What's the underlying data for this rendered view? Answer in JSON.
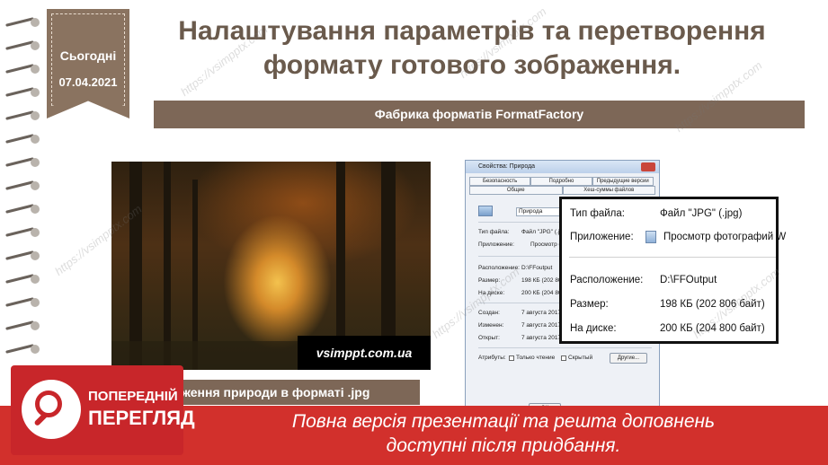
{
  "ribbon": {
    "day": "Сьогодні",
    "date": "07.04.2021"
  },
  "title": {
    "line1": "Налаштування параметрів та перетворення",
    "line2": "формату готового зображення."
  },
  "subtitle": "Фабрика форматів FormatFactory",
  "photo": {
    "watermark": "vsimppt.com.ua"
  },
  "caption": "ження природи в форматі .jpg",
  "dialog": {
    "title": "Свойства: Природа",
    "tabs": [
      "Безопасность",
      "Подробно",
      "Предыдущие версии",
      "Общие",
      "Хеш-суммы файлов"
    ],
    "name": "Природа",
    "type_label": "Тип файла:",
    "type_value": "Файл \"JPG\" (.jp",
    "app_label": "Приложение:",
    "app_value": "Просмотр ф",
    "location_label": "Расположение:",
    "location_value": "D:\\FFoutput",
    "size_label": "Размер:",
    "size_value": "198 КБ (202 80",
    "disk_label": "На диске:",
    "disk_value": "200 КБ (204 80",
    "created_label": "Создан:",
    "created_value": "7 августа 2017",
    "modified_label": "Изменен:",
    "modified_value": "7 августа 2017",
    "opened_label": "Открыт:",
    "opened_value": "7 августа 2017",
    "attrs_label": "Атрибуты:",
    "readonly_label": "Только чтение",
    "hidden_label": "Скрытый",
    "other_button": "Другие...",
    "ok_button": "ОК"
  },
  "zoom": {
    "type_label": "Тип файла:",
    "type_value": "Файл \"JPG\" (.jpg)",
    "app_label": "Приложение:",
    "app_value": "Просмотр фотографий W",
    "location_label": "Расположение:",
    "location_value": "D:\\FFOutput",
    "size_label": "Размер:",
    "size_value": "198 КБ (202 806 байт)",
    "disk_label": "На диске:",
    "disk_value": "200 КБ (204 800 байт)"
  },
  "watermark": "https://vsimpptx.com",
  "banner": {
    "line1": "Повна версія презентації та решта доповнень",
    "line2": "доступні після придбання."
  },
  "preview": {
    "line1": "ПОПЕРЕДНІЙ",
    "line2": "ПЕРЕГЛЯД"
  },
  "colors": {
    "brown": "#7d6757",
    "title": "#6a5a4c",
    "banner": "#d2302c"
  }
}
